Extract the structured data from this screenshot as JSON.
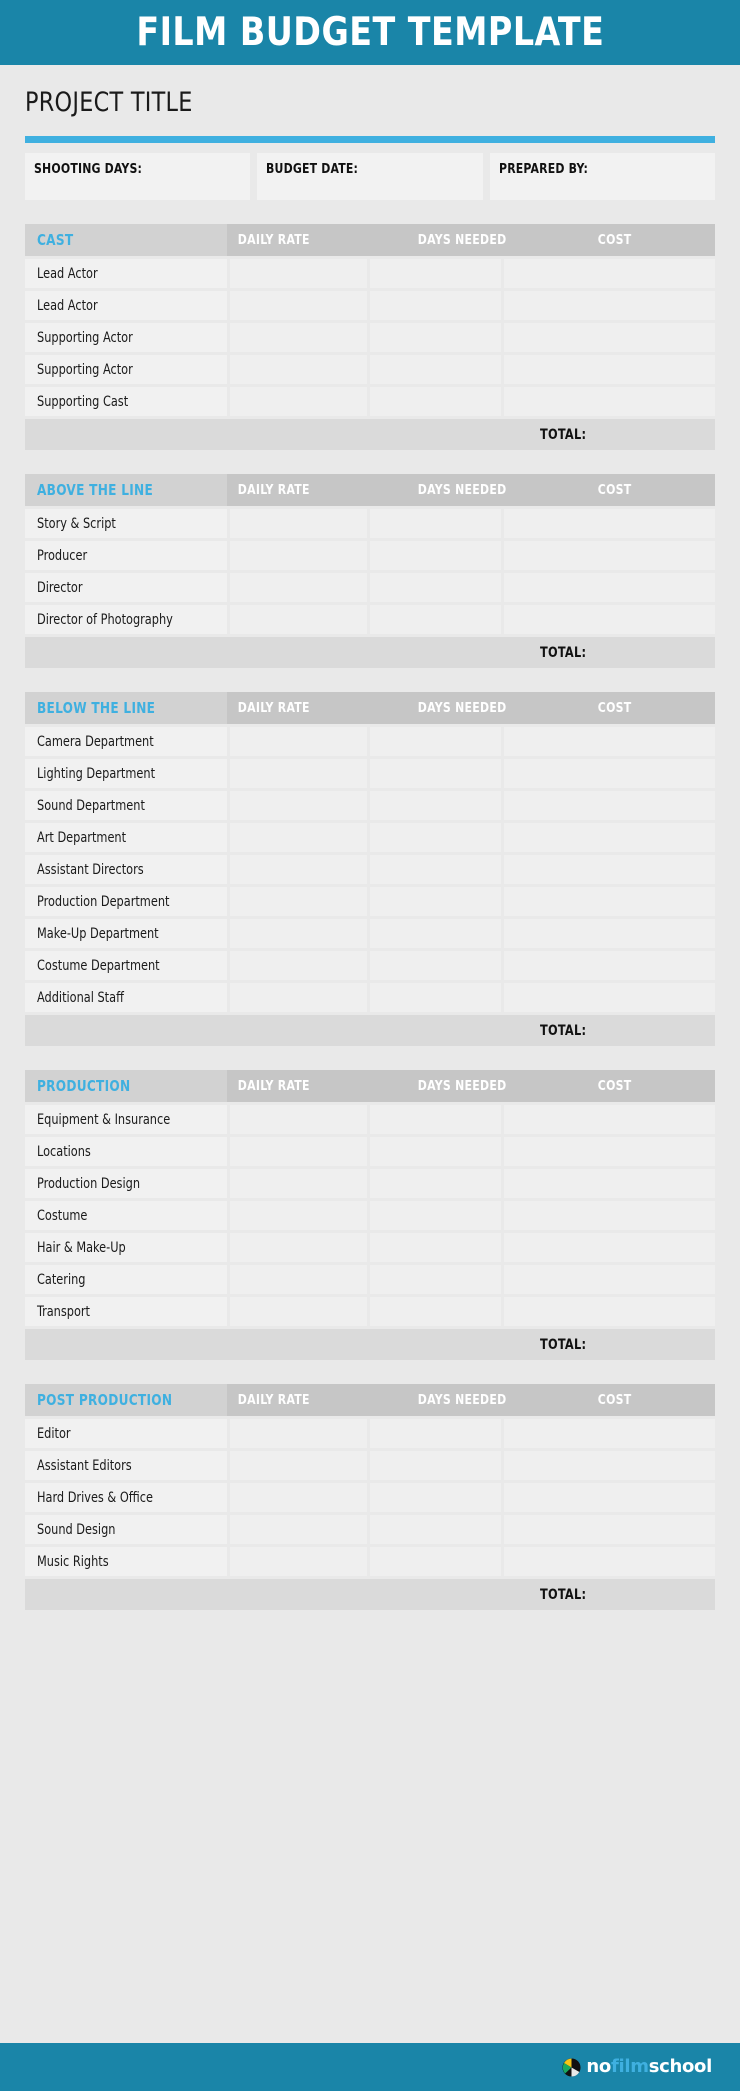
{
  "banner": {
    "title": "FILM BUDGET TEMPLATE"
  },
  "project": {
    "title": "PROJECT TITLE"
  },
  "info_fields": [
    {
      "label": "SHOOTING DAYS:",
      "value": ""
    },
    {
      "label": "BUDGET DATE:",
      "value": ""
    },
    {
      "label": "PREPARED BY:",
      "value": ""
    }
  ],
  "columns": {
    "rate": "DAILY RATE",
    "days": "DAYS NEEDED",
    "cost": "COST"
  },
  "total_label": "TOTAL:",
  "sections": [
    {
      "name": "CAST",
      "items": [
        "Lead Actor",
        "Lead Actor",
        "Supporting Actor",
        "Supporting Actor",
        "Supporting Cast"
      ]
    },
    {
      "name": "ABOVE THE LINE",
      "items": [
        "Story & Script",
        "Producer",
        "Director",
        "Director of Photography"
      ]
    },
    {
      "name": "BELOW THE LINE",
      "items": [
        "Camera Department",
        "Lighting Department",
        "Sound Department",
        "Art Department",
        "Assistant Directors",
        "Production Department",
        "Make-Up Department",
        "Costume Department",
        "Additional Staff"
      ]
    },
    {
      "name": "PRODUCTION",
      "items": [
        "Equipment & Insurance",
        "Locations",
        "Production Design",
        "Costume",
        "Hair & Make-Up",
        "Catering",
        "Transport"
      ]
    },
    {
      "name": "POST PRODUCTION",
      "items": [
        "Editor",
        "Assistant Editors",
        "Hard Drives & Office",
        "Sound Design",
        "Music Rights"
      ]
    }
  ],
  "footer": {
    "logo_icon": "nofilmschool-circle-icon",
    "logo_part1": "no",
    "logo_part2": "film",
    "logo_part3": "school"
  },
  "colors": {
    "brand_teal": "#1a85a8",
    "accent_blue": "#3fb0e0",
    "page_bg": "#e9e9e9",
    "section_name_bg": "#d2d2d2",
    "column_head_bg": "#c6c6c6",
    "row_bg": "#f1f1f1",
    "total_bg": "#dadada"
  }
}
